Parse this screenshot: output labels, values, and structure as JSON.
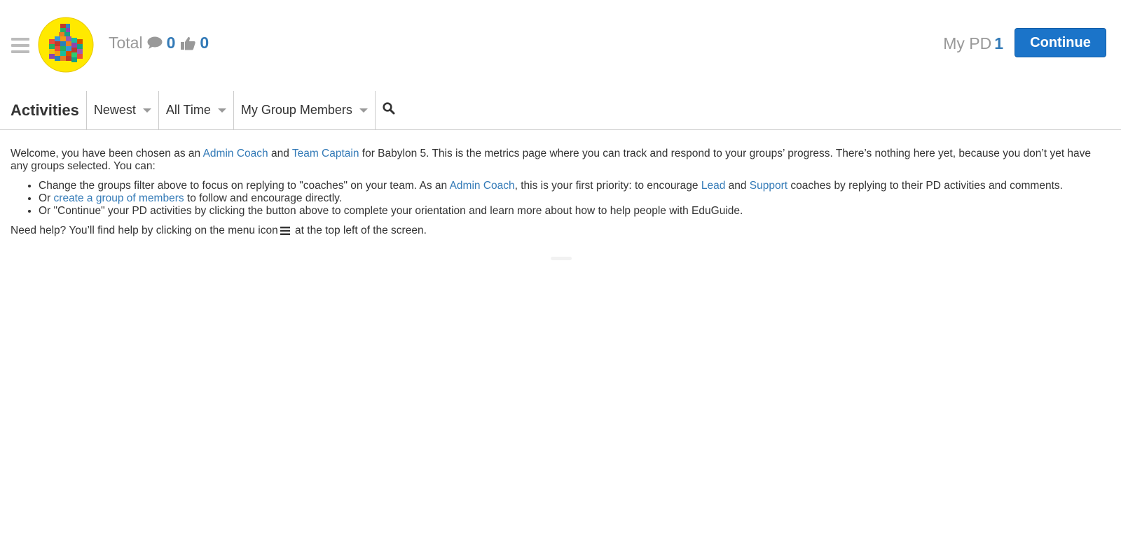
{
  "header": {
    "logo_name": "thumbs-up-mosaic-logo",
    "total_label": "Total",
    "comments_count": "0",
    "likes_count": "0",
    "mypd_label": "My PD",
    "mypd_count": "1",
    "continue_label": "Continue"
  },
  "filters": {
    "title": "Activities",
    "sort": "Newest",
    "time": "All Time",
    "group": "My Group Members"
  },
  "content": {
    "p1": {
      "t1": "Welcome, you have been chosen as an ",
      "link1": "Admin Coach",
      "t2": " and ",
      "link2": "Team Captain",
      "t3": " for Babylon 5. This is the metrics page where you can track and respond to your groups’ progress. There’s nothing here yet, because you don’t yet have any groups selected. You can:"
    },
    "li1": {
      "t1": "Change the groups filter above to focus on replying to \"coaches\" on your team. As an ",
      "link1": "Admin Coach",
      "t2": ", this is your first priority: to encourage ",
      "link2": "Lead",
      "t3": " and ",
      "link3": "Support",
      "t4": " coaches by replying to their PD activities and comments."
    },
    "li2": {
      "t1": "Or ",
      "link1": "create a group of members",
      "t2": " to follow and encourage directly."
    },
    "li3": {
      "t1": "Or \"Continue\" your PD activities by clicking the button above to complete your orientation and learn more about how to help people with EduGuide."
    },
    "help": {
      "t1": "Need help? You’ll find help by clicking on the menu icon",
      "t2": " at the top left of the screen."
    }
  },
  "colors": {
    "link": "#337ab7",
    "button": "#1b74c9",
    "muted": "#999999"
  }
}
